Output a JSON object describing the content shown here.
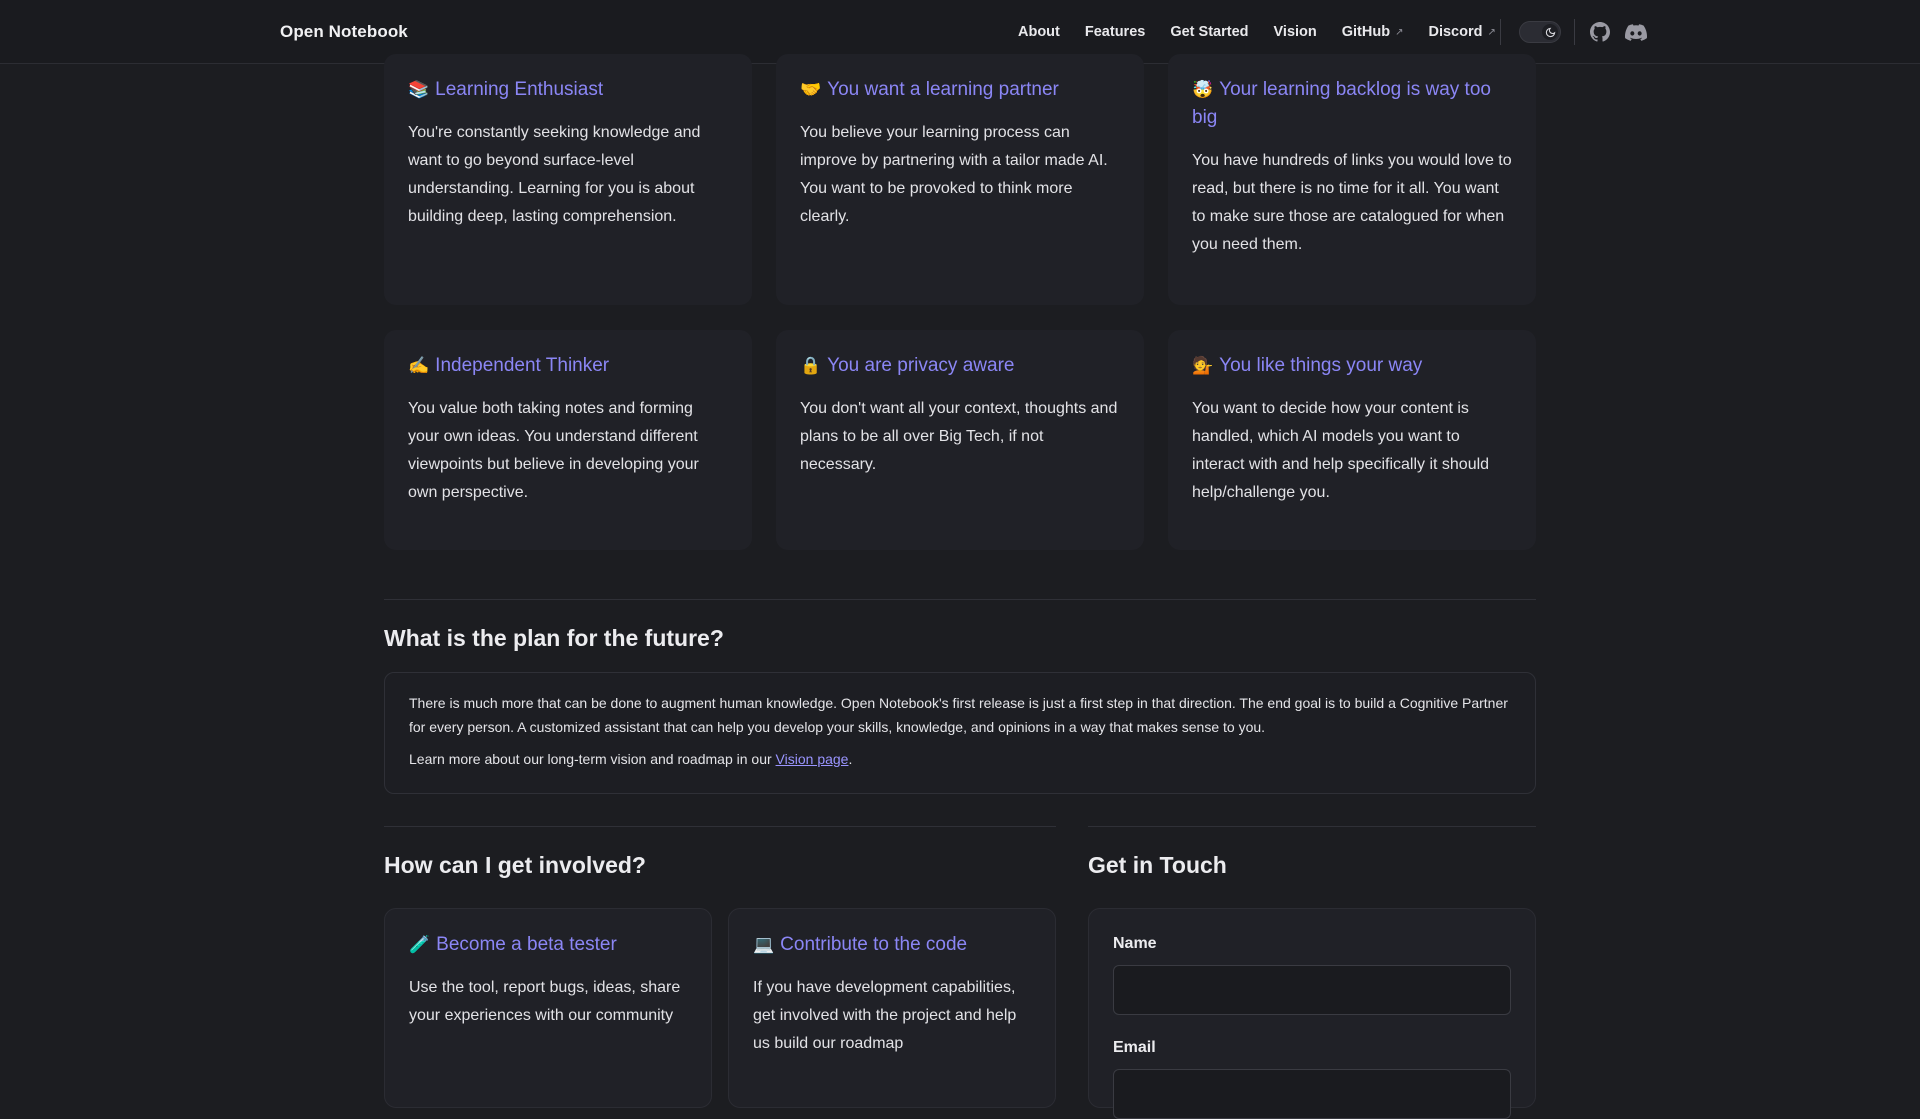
{
  "header": {
    "brand": "Open Notebook",
    "nav": [
      {
        "label": "About"
      },
      {
        "label": "Features"
      },
      {
        "label": "Get Started"
      },
      {
        "label": "Vision"
      },
      {
        "label": "GitHub",
        "external": "↗"
      },
      {
        "label": "Discord",
        "external": "↗"
      }
    ],
    "icons": [
      "moon-icon",
      "github-icon",
      "discord-icon"
    ]
  },
  "personas": [
    {
      "emoji": "📚",
      "title": "Learning Enthusiast",
      "text": "You're constantly seeking knowledge and want to go beyond surface-level understanding. Learning for you is about building deep, lasting comprehension."
    },
    {
      "emoji": "🤝",
      "title": "You want a learning partner",
      "text": "You believe your learning process can improve by partnering with a tailor made AI. You want to be provoked to think more clearly."
    },
    {
      "emoji": "🤯",
      "title": "Your learning backlog is way too big",
      "text": "You have hundreds of links you would love to read, but there is no time for it all. You want to make sure those are catalogued for when you need them."
    },
    {
      "emoji": "✍️",
      "title": "Independent Thinker",
      "text": "You value both taking notes and forming your own ideas. You understand different viewpoints but believe in developing your own perspective."
    },
    {
      "emoji": "🔒",
      "title": "You are privacy aware",
      "text": "You don't want all your context, thoughts and plans to be all over Big Tech, if not necessary."
    },
    {
      "emoji": "💁",
      "title": "You like things your way",
      "text": "You want to decide how your content is handled, which AI models you want to interact with and help specifically it should help/challenge you."
    }
  ],
  "plan": {
    "title": "What is the plan for the future?",
    "paragraph": "There is much more that can be done to augment human knowledge. Open Notebook's first release is just a first step in that direction. The end goal is to build a Cognitive Partner for every person. A customized assistant that can help you develop your skills, knowledge, and opinions in a way that makes sense to you.",
    "vision_prefix": "Learn more about our long-term vision and roadmap in our ",
    "vision_link": "Vision page",
    "vision_suffix": "."
  },
  "involved": {
    "title": "How can I get involved?",
    "cards": [
      {
        "emoji": "🧪",
        "title": "Become a beta tester",
        "text": "Use the tool, report bugs, ideas, share your experiences with our community"
      },
      {
        "emoji": "💻",
        "title": "Contribute to the code",
        "text": "If you have development capabilities, get involved with the project and help us build our roadmap"
      }
    ]
  },
  "contact": {
    "title": "Get in Touch",
    "name_label": "Name",
    "name_value": "",
    "email_label": "Email",
    "email_value": ""
  },
  "colors": {
    "background": "#1c1d21",
    "card": "#202127",
    "accent": "#8b86f5",
    "link": "#9a95ff"
  }
}
